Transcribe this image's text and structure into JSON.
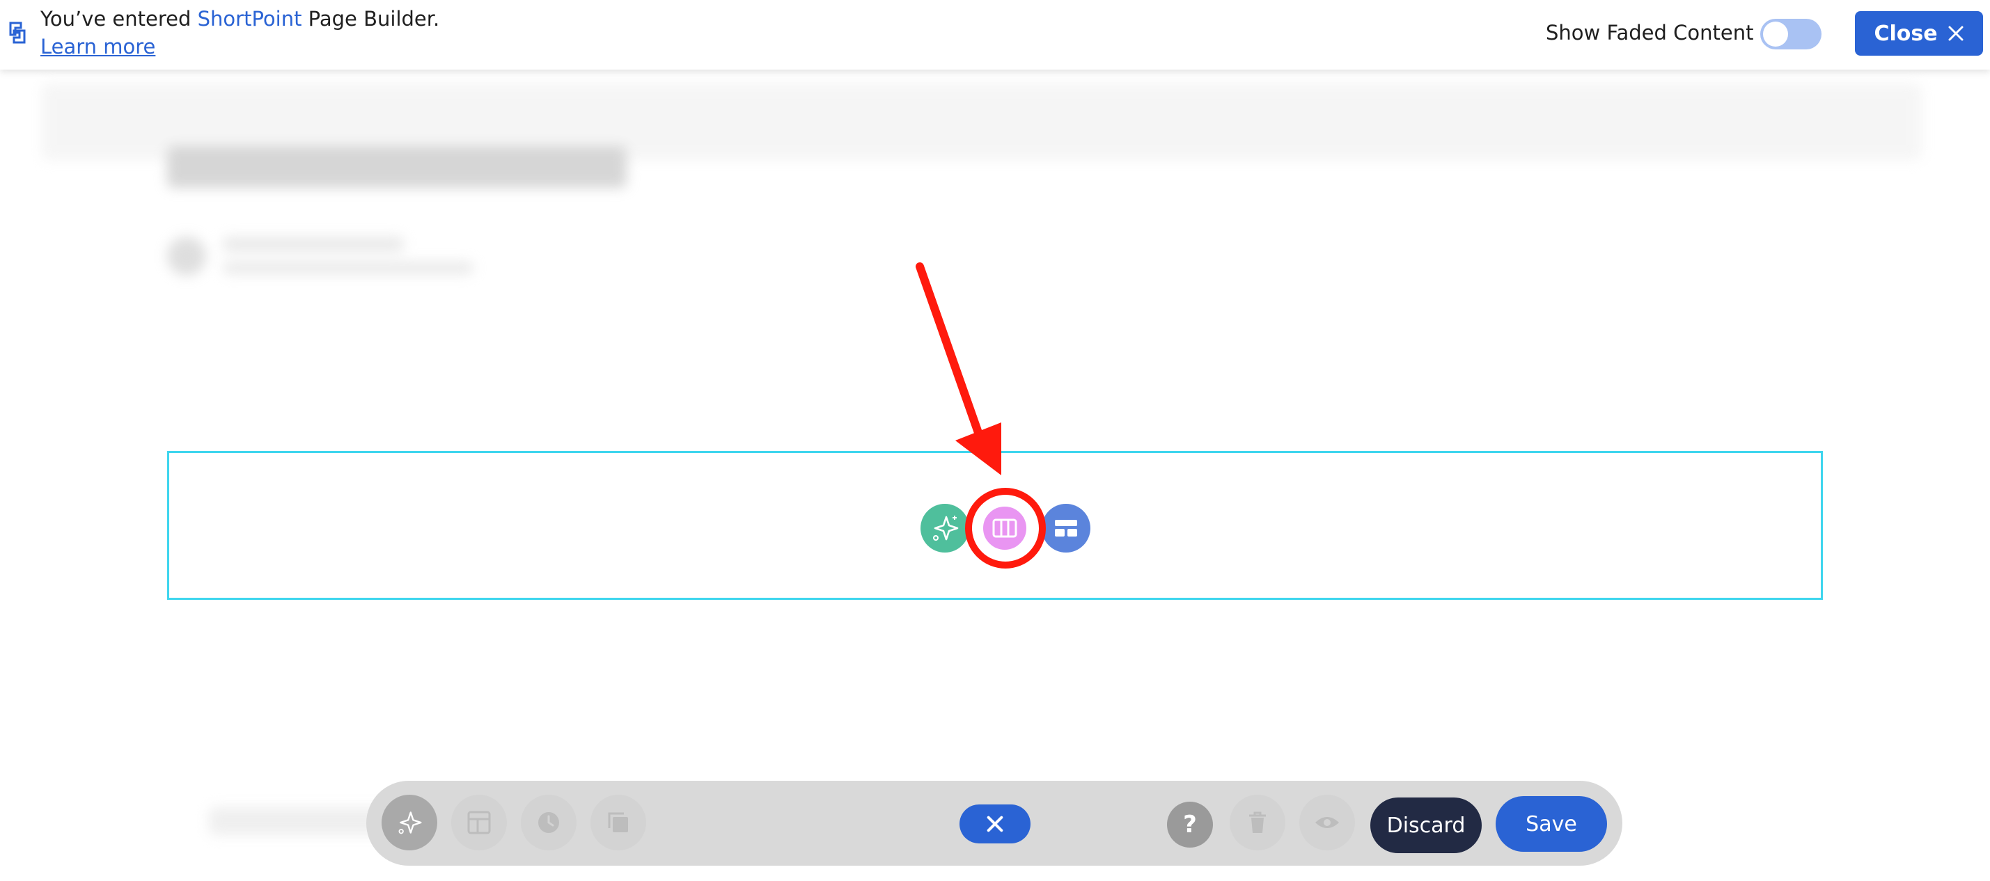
{
  "banner": {
    "prefix": "You’ve entered ",
    "brand": "ShortPoint",
    "suffix": " Page Builder.",
    "learn_more": "Learn more",
    "show_faded_label": "Show Faded Content",
    "show_faded_enabled": false,
    "close_label": "Close"
  },
  "section": {
    "buttons": [
      "sparkle-icon",
      "columns-icon",
      "layout-icon"
    ],
    "highlighted": "columns-icon"
  },
  "toolbar": {
    "discard_label": "Discard",
    "save_label": "Save",
    "help_label": "?"
  },
  "colors": {
    "accent": "#2a63d4",
    "section_outline": "#3fd6ee",
    "ai_button": "#4fbf9c",
    "columns_button": "#e995f2",
    "layout_button": "#5b84dc",
    "annotation_red": "#ff1a0d",
    "discard_bg": "#222a44"
  }
}
